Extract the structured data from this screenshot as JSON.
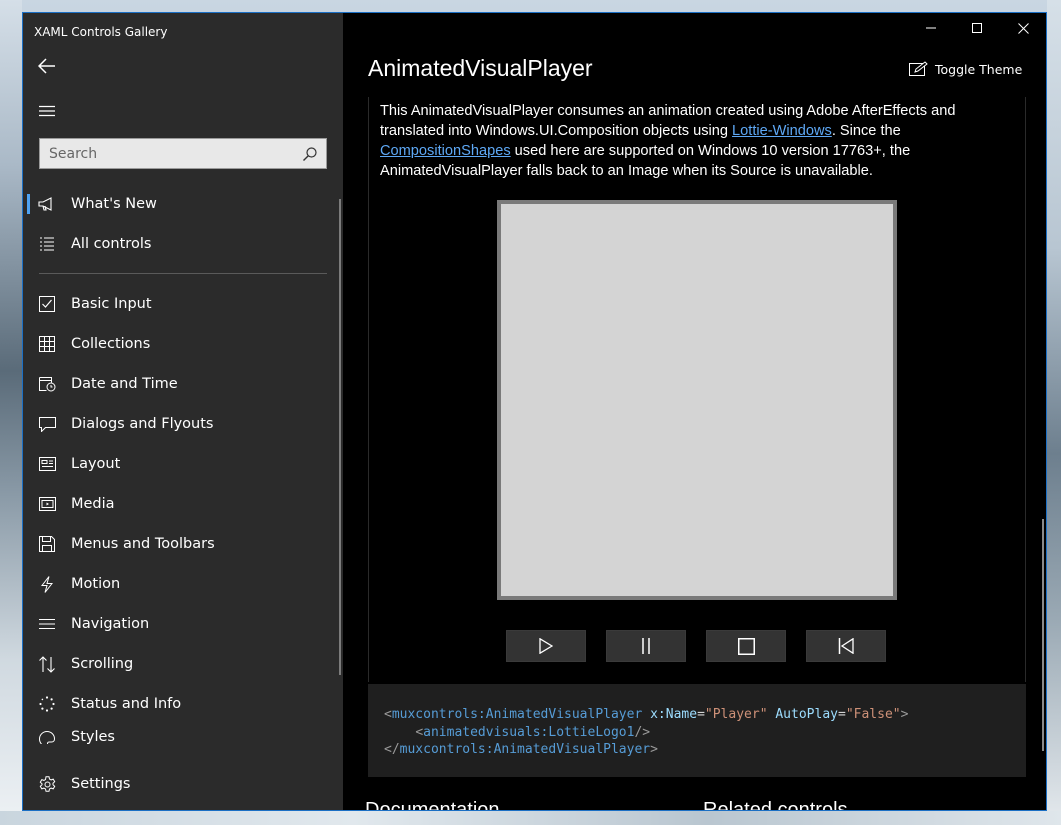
{
  "window": {
    "app_title": "XAML Controls Gallery",
    "caption": {
      "minimize": "minimize-icon",
      "maximize": "maximize-icon",
      "close": "close-icon"
    }
  },
  "sidebar": {
    "search": {
      "placeholder": "Search",
      "value": ""
    },
    "top_items": [
      {
        "label": "What's New",
        "icon": "megaphone-icon",
        "selected": true
      },
      {
        "label": "All controls",
        "icon": "list-icon"
      }
    ],
    "category_items": [
      {
        "label": "Basic Input",
        "icon": "checkbox-icon"
      },
      {
        "label": "Collections",
        "icon": "grid-icon"
      },
      {
        "label": "Date and Time",
        "icon": "calendar-clock-icon"
      },
      {
        "label": "Dialogs and Flyouts",
        "icon": "speech-bubble-icon"
      },
      {
        "label": "Layout",
        "icon": "layout-icon"
      },
      {
        "label": "Media",
        "icon": "media-icon"
      },
      {
        "label": "Menus and Toolbars",
        "icon": "save-icon"
      },
      {
        "label": "Motion",
        "icon": "lightning-icon"
      },
      {
        "label": "Navigation",
        "icon": "navigation-icon"
      },
      {
        "label": "Scrolling",
        "icon": "scroll-arrows-icon"
      },
      {
        "label": "Status and Info",
        "icon": "progress-ring-icon"
      },
      {
        "label": "Styles",
        "icon": "palette-icon"
      }
    ],
    "settings_label": "Settings"
  },
  "main": {
    "page_title": "AnimatedVisualPlayer",
    "toggle_theme_label": "Toggle Theme",
    "description": {
      "part1": "This AnimatedVisualPlayer consumes an animation created using Adobe AfterEffects and translated into Windows.UI.Composition objects using ",
      "link1": "Lottie-Windows",
      "part2": ". Since the ",
      "link2": "CompositionShapes",
      "part3": " used here are supported on Windows 10 version 17763+, the AnimatedVisualPlayer falls back to an Image when its Source is unavailable."
    },
    "player_controls": [
      {
        "name": "play-button",
        "icon": "play-icon"
      },
      {
        "name": "pause-button",
        "icon": "pause-icon"
      },
      {
        "name": "stop-button",
        "icon": "stop-icon"
      },
      {
        "name": "rewind-button",
        "icon": "skip-back-icon"
      }
    ],
    "code": {
      "line1": {
        "open": "<",
        "tag": "muxcontrols:AnimatedVisualPlayer",
        "attr1": "x:Name",
        "val1": "\"Player\"",
        "attr2": "AutoPlay",
        "val2": "\"False\"",
        "close": ">"
      },
      "line2": {
        "indent": "    ",
        "open": "<",
        "tag": "animatedvisuals:LottieLogo1",
        "close": "/>"
      },
      "line3": {
        "open": "</",
        "tag": "muxcontrols:AnimatedVisualPlayer",
        "close": ">"
      }
    },
    "footer": {
      "documentation": "Documentation",
      "related": "Related controls"
    }
  }
}
